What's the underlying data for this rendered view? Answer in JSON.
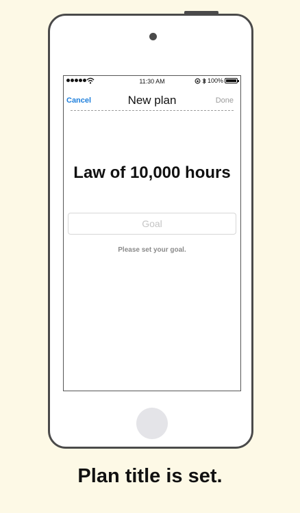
{
  "status_bar": {
    "time": "11:30 AM",
    "battery": "100%",
    "signal_dots": 5
  },
  "nav": {
    "cancel_label": "Cancel",
    "title": "New plan",
    "done_label": "Done"
  },
  "plan": {
    "title": "Law of 10,000 hours",
    "goal_placeholder": "Goal",
    "goal_value": "",
    "hint": "Please set your goal."
  },
  "caption": "Plan title is set.",
  "colors": {
    "background": "#fdf9e6",
    "accent": "#1e7fdc",
    "disabled": "#9a9a9a",
    "device_frame": "#4a4a4a"
  }
}
